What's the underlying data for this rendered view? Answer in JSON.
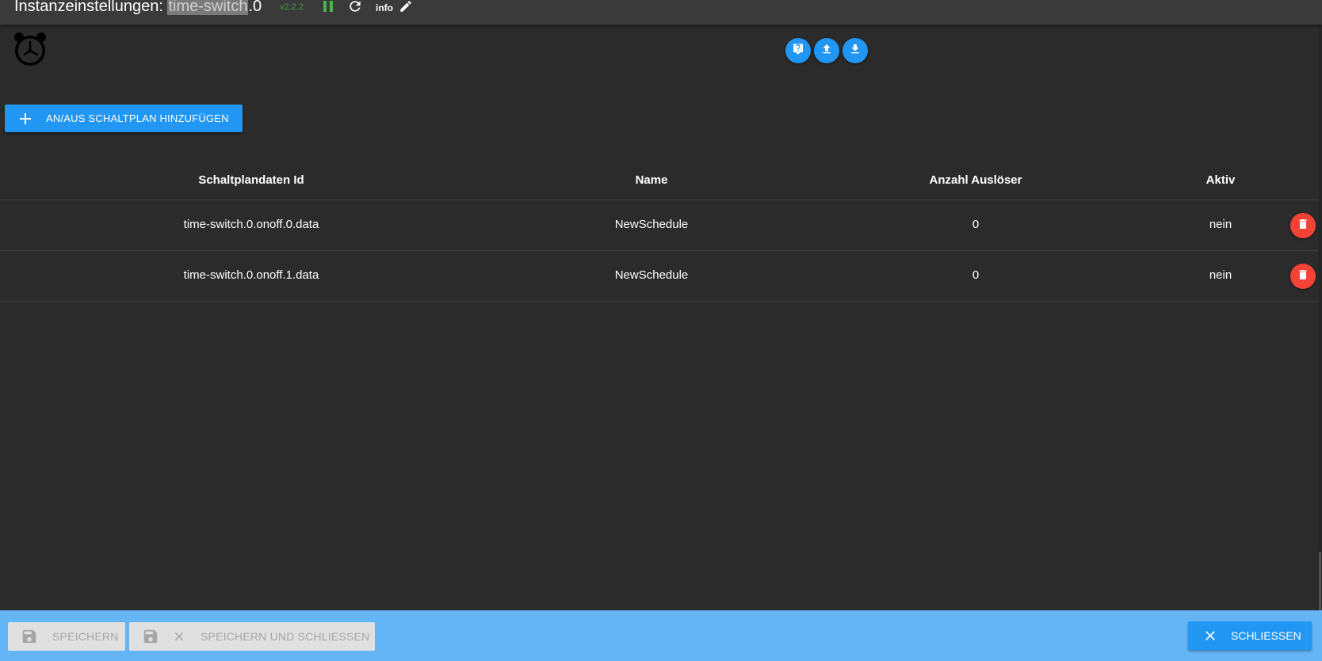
{
  "header": {
    "title_prefix": "Instanzeinstellungen: ",
    "title_adapter": "time-switch",
    "title_suffix": ".0",
    "version": "v2.2.2",
    "info_label": "info"
  },
  "toolbar": {
    "add_label": "AN/AUS SCHALTPLAN HINZUFÜGEN"
  },
  "table": {
    "headers": [
      "Schaltplandaten Id",
      "Name",
      "Anzahl Auslöser",
      "Aktiv"
    ],
    "rows": [
      {
        "id": "time-switch.0.onoff.0.data",
        "name": "NewSchedule",
        "triggers": "0",
        "active": "nein"
      },
      {
        "id": "time-switch.0.onoff.1.data",
        "name": "NewSchedule",
        "triggers": "0",
        "active": "nein"
      }
    ]
  },
  "footer": {
    "save_label": "SPEICHERN",
    "save_close_label": "SPEICHERN UND SCHLIESSEN",
    "close_label": "SCHLIESSEN"
  },
  "colors": {
    "background": "#2b2b2b",
    "header": "#3a3a3a",
    "accent": "#2196f3",
    "footer": "#64b5f6",
    "delete": "#f44336",
    "version": "#3f9b3f"
  },
  "icons": {
    "logo": "alarm-clock-icon",
    "help": "help-icon",
    "upload": "upload-icon",
    "download": "download-icon",
    "pause": "pause-icon",
    "reload": "reload-icon",
    "edit": "pencil-icon",
    "delete": "trash-icon",
    "save": "floppy-icon",
    "close": "close-icon",
    "add": "plus-icon"
  }
}
